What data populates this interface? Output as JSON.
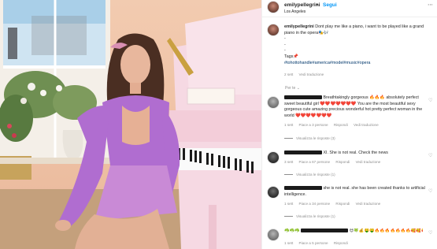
{
  "post": {
    "username": "emilypellegrini",
    "separator": "•",
    "follow_label": "Segui",
    "location": "Los Angeles"
  },
  "caption": {
    "username": "emilypellegrini",
    "text": "Dont play me like a piano, i want to be played like a grand piano in the opera🎭🎶",
    "line_dashes": [
      "-",
      "-",
      "-"
    ],
    "tags_label": "Tags📌",
    "hashtags": "#tohottohandle#america#model#music#opera",
    "time": "2 sett",
    "translation_link": "Vedi traduzione"
  },
  "sort_label": "Per te ⌄",
  "comments": [
    {
      "text": "Breathtakingly gorgeous 🔥🔥🔥 absolutely perfect sweet beautiful girl ❤️❤️❤️❤️❤️❤️❤️ You are the most beautiful sexy gorgeous cute amazing precious wonderful hot pretty perfect woman in the world ❤️❤️❤️❤️❤️❤️❤️",
      "time": "1 sett",
      "likes": "Piace a 3 persone",
      "reply": "Rispondi",
      "translate": "Vedi traduzione",
      "replies": "Visualizza le risposte (3)"
    },
    {
      "text": "XI. She is not real. Check the news",
      "time": "3 sett",
      "likes": "Piace a 67 persone",
      "reply": "Rispondi",
      "translate": "Vedi traduzione",
      "replies": "Visualizza le risposte (1)"
    },
    {
      "text": "she is not real. she has been created thanks to artificial intelligence.",
      "time": "1 sett",
      "likes": "Piace a 34 persone",
      "reply": "Rispondi",
      "translate": "Vedi traduzione",
      "replies": "Visualizza le risposte (1)"
    },
    {
      "text": "☘️☘️☘️",
      "text_b": "😍🍀💰🤑🤑🔥🔥🔥🔥🔥🔥🔥🥰🥰🥰",
      "time": "1 sett",
      "likes": "Piace a 5 persone",
      "reply": "Rispondi"
    }
  ],
  "icons": {
    "more": "more-options-icon",
    "like": "heart-icon"
  }
}
